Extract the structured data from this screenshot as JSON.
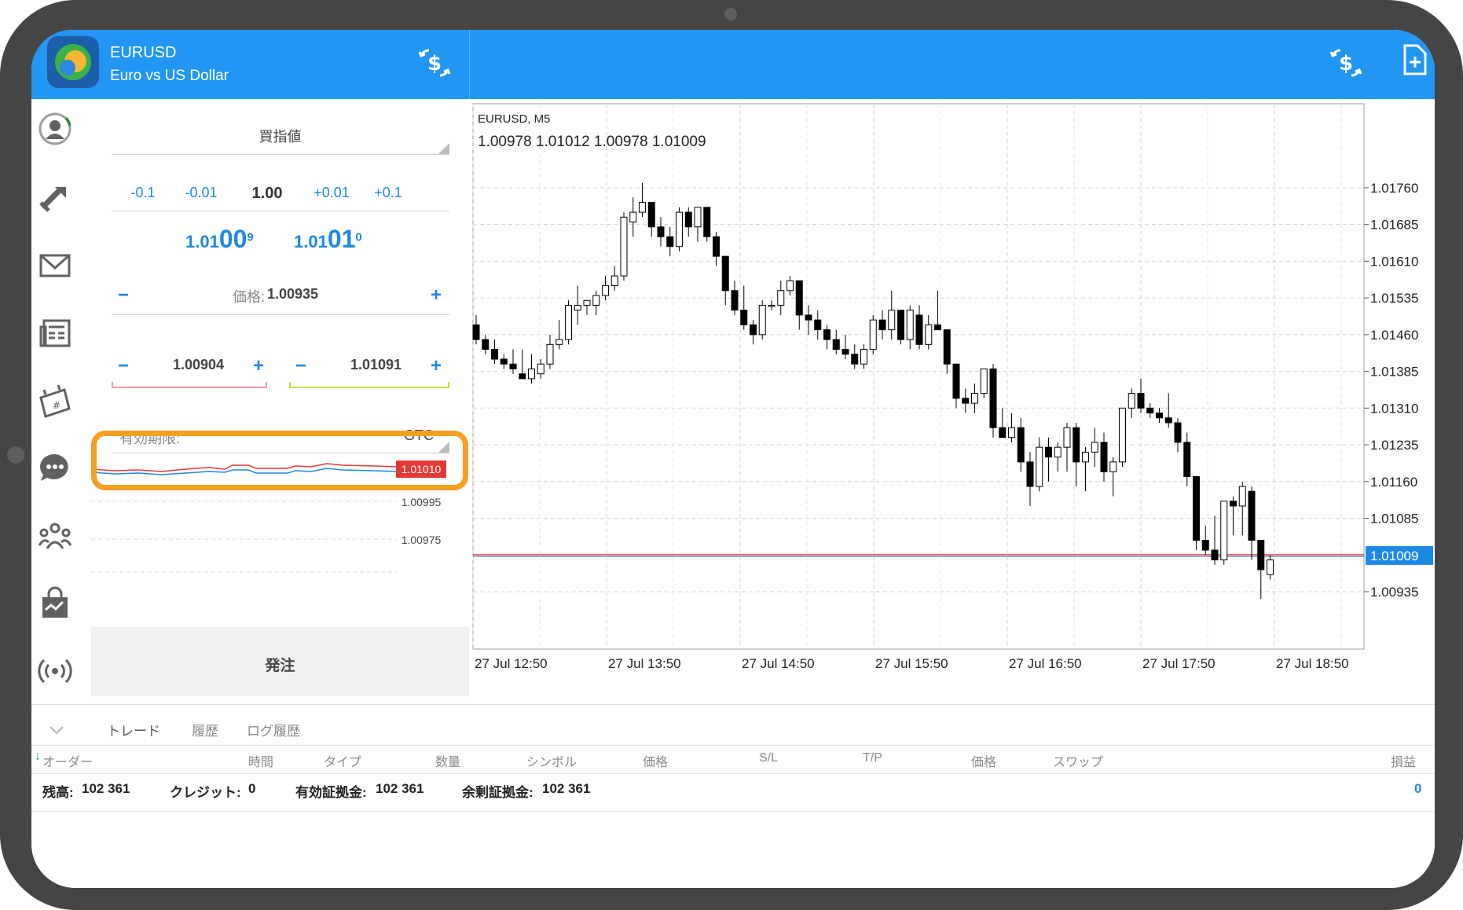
{
  "window": {
    "symbol": "EURUSD",
    "description": "Euro vs US Dollar"
  },
  "icons": {
    "logo": "metatrader-icon",
    "trade_settings": "dollar-swap-icon",
    "new_order": "new-document-icon"
  },
  "nav": [
    "account-icon",
    "trade-arrows-icon",
    "mail-icon",
    "news-icon",
    "calendar-icon",
    "chat-icon",
    "community-icon",
    "market-icon",
    "signal-icon"
  ],
  "order": {
    "order_type": "買指値",
    "volume_steps": [
      "-0.1",
      "-0.01",
      "1.00",
      "+0.01",
      "+0.1"
    ],
    "bid": {
      "prefix": "1.01",
      "big": "00",
      "sup": "9"
    },
    "ask": {
      "prefix": "1.01",
      "big": "01",
      "sup": "0"
    },
    "price_label": "価格:",
    "price_value": "1.00935",
    "sl_value": "1.00904",
    "tp_value": "1.01091",
    "expiry_label": "有効期限:",
    "expiry_value": "GTC",
    "submit": "発注",
    "minus": "−",
    "plus": "+"
  },
  "tick_chart": {
    "current": "1.01010",
    "levels": [
      "1.00995",
      "1.00975"
    ],
    "colors": {
      "bid": "#e53935",
      "ask": "#1e88e5"
    }
  },
  "chart_data": {
    "type": "candlestick",
    "title": "EURUSD, M5",
    "ohlc_label": "1.00978 1.01012 1.00978 1.01009",
    "y_ticks": [
      "1.01760",
      "1.01685",
      "1.01610",
      "1.01535",
      "1.01460",
      "1.01385",
      "1.01310",
      "1.01235",
      "1.01160",
      "1.01085",
      "1.00935"
    ],
    "x_ticks": [
      "27 Jul 12:50",
      "27 Jul 13:50",
      "27 Jul 14:50",
      "27 Jul 15:50",
      "27 Jul 16:50",
      "27 Jul 17:50",
      "27 Jul 18:50"
    ],
    "current_price": "1.01009",
    "ylim": [
      1.0089,
      1.018
    ],
    "grid": true,
    "candles": [
      [
        1.0148,
        1.015,
        1.0144,
        1.0145
      ],
      [
        1.0145,
        1.0146,
        1.0142,
        1.0143
      ],
      [
        1.0143,
        1.0145,
        1.014,
        1.0141
      ],
      [
        1.0141,
        1.0142,
        1.0139,
        1.014
      ],
      [
        1.014,
        1.0143,
        1.0138,
        1.0139
      ],
      [
        1.0138,
        1.0143,
        1.0137,
        1.0137
      ],
      [
        1.0137,
        1.0142,
        1.0136,
        1.0139
      ],
      [
        1.0138,
        1.0141,
        1.0137,
        1.014
      ],
      [
        1.014,
        1.0146,
        1.0139,
        1.0144
      ],
      [
        1.0144,
        1.0149,
        1.0143,
        1.0145
      ],
      [
        1.0145,
        1.0153,
        1.0144,
        1.0152
      ],
      [
        1.0151,
        1.0156,
        1.0148,
        1.0152
      ],
      [
        1.0152,
        1.0153,
        1.015,
        1.0153
      ],
      [
        1.0152,
        1.0155,
        1.015,
        1.0154
      ],
      [
        1.0154,
        1.0158,
        1.0153,
        1.0156
      ],
      [
        1.0156,
        1.016,
        1.0155,
        1.0158
      ],
      [
        1.0158,
        1.0171,
        1.0157,
        1.017
      ],
      [
        1.0169,
        1.0174,
        1.0166,
        1.0171
      ],
      [
        1.0171,
        1.0177,
        1.017,
        1.0173
      ],
      [
        1.0173,
        1.0173,
        1.0166,
        1.0168
      ],
      [
        1.0168,
        1.017,
        1.0164,
        1.0166
      ],
      [
        1.0166,
        1.0168,
        1.0162,
        1.0164
      ],
      [
        1.0164,
        1.0172,
        1.0163,
        1.0171
      ],
      [
        1.0171,
        1.0172,
        1.0166,
        1.0168
      ],
      [
        1.0168,
        1.0172,
        1.0165,
        1.0172
      ],
      [
        1.0172,
        1.0172,
        1.0165,
        1.0166
      ],
      [
        1.0166,
        1.0167,
        1.016,
        1.0162
      ],
      [
        1.0162,
        1.0162,
        1.0152,
        1.0155
      ],
      [
        1.0155,
        1.0157,
        1.015,
        1.0151
      ],
      [
        1.0151,
        1.0156,
        1.0147,
        1.0148
      ],
      [
        1.0148,
        1.0149,
        1.0144,
        1.0146
      ],
      [
        1.0146,
        1.0153,
        1.0145,
        1.0152
      ],
      [
        1.0152,
        1.0153,
        1.0151,
        1.0152
      ],
      [
        1.0152,
        1.0157,
        1.015,
        1.0155
      ],
      [
        1.0155,
        1.0158,
        1.0154,
        1.0157
      ],
      [
        1.0157,
        1.0157,
        1.0147,
        1.015
      ],
      [
        1.015,
        1.0152,
        1.0146,
        1.0149
      ],
      [
        1.0149,
        1.0151,
        1.0145,
        1.0147
      ],
      [
        1.0147,
        1.0148,
        1.0143,
        1.0145
      ],
      [
        1.0145,
        1.0147,
        1.0142,
        1.0143
      ],
      [
        1.0143,
        1.0146,
        1.0141,
        1.0142
      ],
      [
        1.0142,
        1.0144,
        1.0139,
        1.014
      ],
      [
        1.014,
        1.0144,
        1.0139,
        1.0143
      ],
      [
        1.0143,
        1.015,
        1.0142,
        1.0149
      ],
      [
        1.0149,
        1.0151,
        1.0145,
        1.0147
      ],
      [
        1.0147,
        1.0155,
        1.0145,
        1.0151
      ],
      [
        1.0151,
        1.0151,
        1.0144,
        1.0145
      ],
      [
        1.0145,
        1.0152,
        1.0143,
        1.0151
      ],
      [
        1.015,
        1.0152,
        1.0143,
        1.0144
      ],
      [
        1.0144,
        1.015,
        1.0143,
        1.0148
      ],
      [
        1.0148,
        1.0155,
        1.0147,
        1.0147
      ],
      [
        1.0147,
        1.0147,
        1.0138,
        1.014
      ],
      [
        1.014,
        1.014,
        1.0131,
        1.0133
      ],
      [
        1.0133,
        1.0135,
        1.013,
        1.0132
      ],
      [
        1.0132,
        1.0136,
        1.013,
        1.0134
      ],
      [
        1.0134,
        1.0139,
        1.0133,
        1.0139
      ],
      [
        1.0139,
        1.014,
        1.0125,
        1.0127
      ],
      [
        1.0127,
        1.0131,
        1.0125,
        1.0125
      ],
      [
        1.0125,
        1.013,
        1.0124,
        1.0127
      ],
      [
        1.0127,
        1.0129,
        1.0118,
        1.012
      ],
      [
        1.012,
        1.0122,
        1.0111,
        1.0115
      ],
      [
        1.0115,
        1.0125,
        1.0114,
        1.0123
      ],
      [
        1.0123,
        1.0125,
        1.0116,
        1.0121
      ],
      [
        1.0121,
        1.0124,
        1.0118,
        1.0123
      ],
      [
        1.0123,
        1.0128,
        1.0118,
        1.0127
      ],
      [
        1.0127,
        1.0128,
        1.0115,
        1.012
      ],
      [
        1.012,
        1.0123,
        1.0114,
        1.0122
      ],
      [
        1.0122,
        1.0127,
        1.0119,
        1.0124
      ],
      [
        1.0124,
        1.0126,
        1.0116,
        1.0118
      ],
      [
        1.0118,
        1.0121,
        1.0113,
        1.012
      ],
      [
        1.012,
        1.0131,
        1.0119,
        1.0131
      ],
      [
        1.0131,
        1.0135,
        1.0129,
        1.0134
      ],
      [
        1.0134,
        1.0137,
        1.013,
        1.0131
      ],
      [
        1.0131,
        1.0132,
        1.0129,
        1.013
      ],
      [
        1.013,
        1.0131,
        1.0128,
        1.0129
      ],
      [
        1.0129,
        1.0134,
        1.0127,
        1.0128
      ],
      [
        1.0128,
        1.0129,
        1.0122,
        1.0124
      ],
      [
        1.0124,
        1.0126,
        1.0115,
        1.0117
      ],
      [
        1.0117,
        1.0117,
        1.0102,
        1.0104
      ],
      [
        1.0104,
        1.0107,
        1.0101,
        1.0102
      ],
      [
        1.0102,
        1.0109,
        1.0099,
        1.01
      ],
      [
        1.01,
        1.0112,
        1.0099,
        1.0112
      ],
      [
        1.0112,
        1.0113,
        1.0105,
        1.0111
      ],
      [
        1.0111,
        1.0116,
        1.0105,
        1.0115
      ],
      [
        1.0114,
        1.0115,
        1.01,
        1.0104
      ],
      [
        1.0104,
        1.0104,
        1.0092,
        1.0098
      ],
      [
        1.0097,
        1.0101,
        1.0096,
        1.01
      ]
    ]
  },
  "bottom": {
    "tabs": [
      "トレード",
      "履歴",
      "ログ履歴"
    ],
    "columns": [
      "オーダー",
      "時間",
      "タイプ",
      "数量",
      "シンボル",
      "価格",
      "S/L",
      "T/P",
      "価格",
      "スワップ",
      "損益"
    ],
    "balance_label": "残高:",
    "balance": "102 361",
    "credit_label": "クレジット:",
    "credit": "0",
    "equity_label": "有効証拠金:",
    "equity": "102 361",
    "free_margin_label": "余剰証拠金:",
    "free_margin": "102 361",
    "profit": "0"
  }
}
